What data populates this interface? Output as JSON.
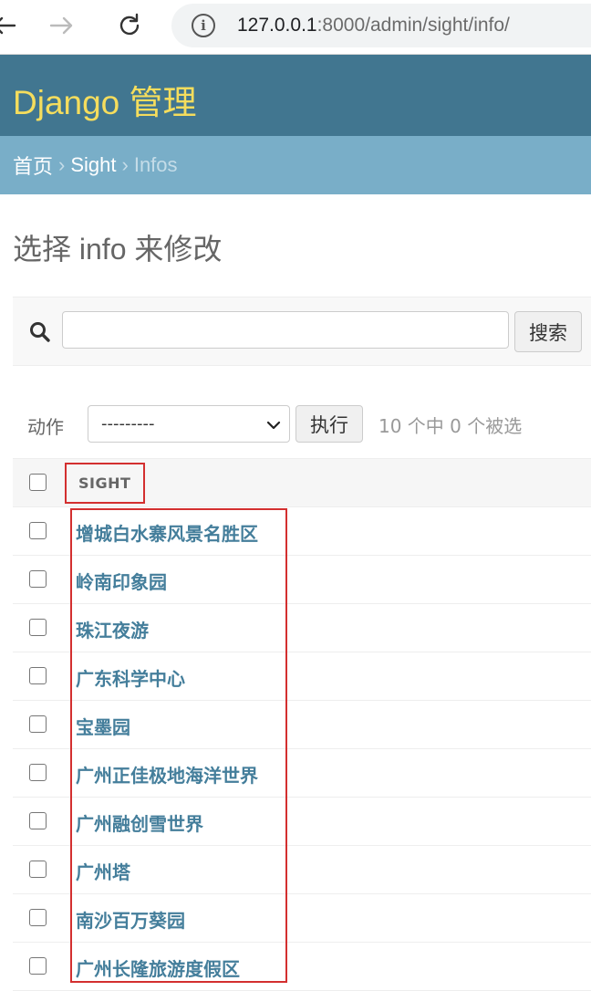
{
  "browser": {
    "url_host": "127.0.0.1",
    "url_rest": ":8000/admin/sight/info/"
  },
  "header": {
    "site_title": "Django 管理"
  },
  "breadcrumbs": {
    "home": "首页",
    "app": "Sight",
    "current": "Infos",
    "separator": "›"
  },
  "page": {
    "title": "选择 info 来修改"
  },
  "search": {
    "value": "",
    "button_label": "搜索"
  },
  "actions": {
    "label": "动作",
    "selected_option": "---------",
    "go_label": "执行",
    "counter": "10 个中 0 个被选"
  },
  "table": {
    "column_header": "SIGHT",
    "rows": [
      {
        "label": "增城白水寨风景名胜区"
      },
      {
        "label": "岭南印象园"
      },
      {
        "label": "珠江夜游"
      },
      {
        "label": "广东科学中心"
      },
      {
        "label": "宝墨园"
      },
      {
        "label": "广州正佳极地海洋世界"
      },
      {
        "label": "广州融创雪世界"
      },
      {
        "label": "广州塔"
      },
      {
        "label": "南沙百万葵园"
      },
      {
        "label": "广州长隆旅游度假区"
      }
    ]
  },
  "colors": {
    "header_bg": "#417690",
    "breadcrumbs_bg": "#79aec8",
    "title_yellow": "#f5dd5d",
    "link": "#447e9b",
    "highlight_red": "#d32f2f"
  },
  "icons": {
    "back": "arrow-left-icon",
    "forward": "arrow-right-icon",
    "reload": "reload-icon",
    "site_info": "info-icon",
    "search": "search-icon",
    "select": "chevron-down-icon"
  }
}
